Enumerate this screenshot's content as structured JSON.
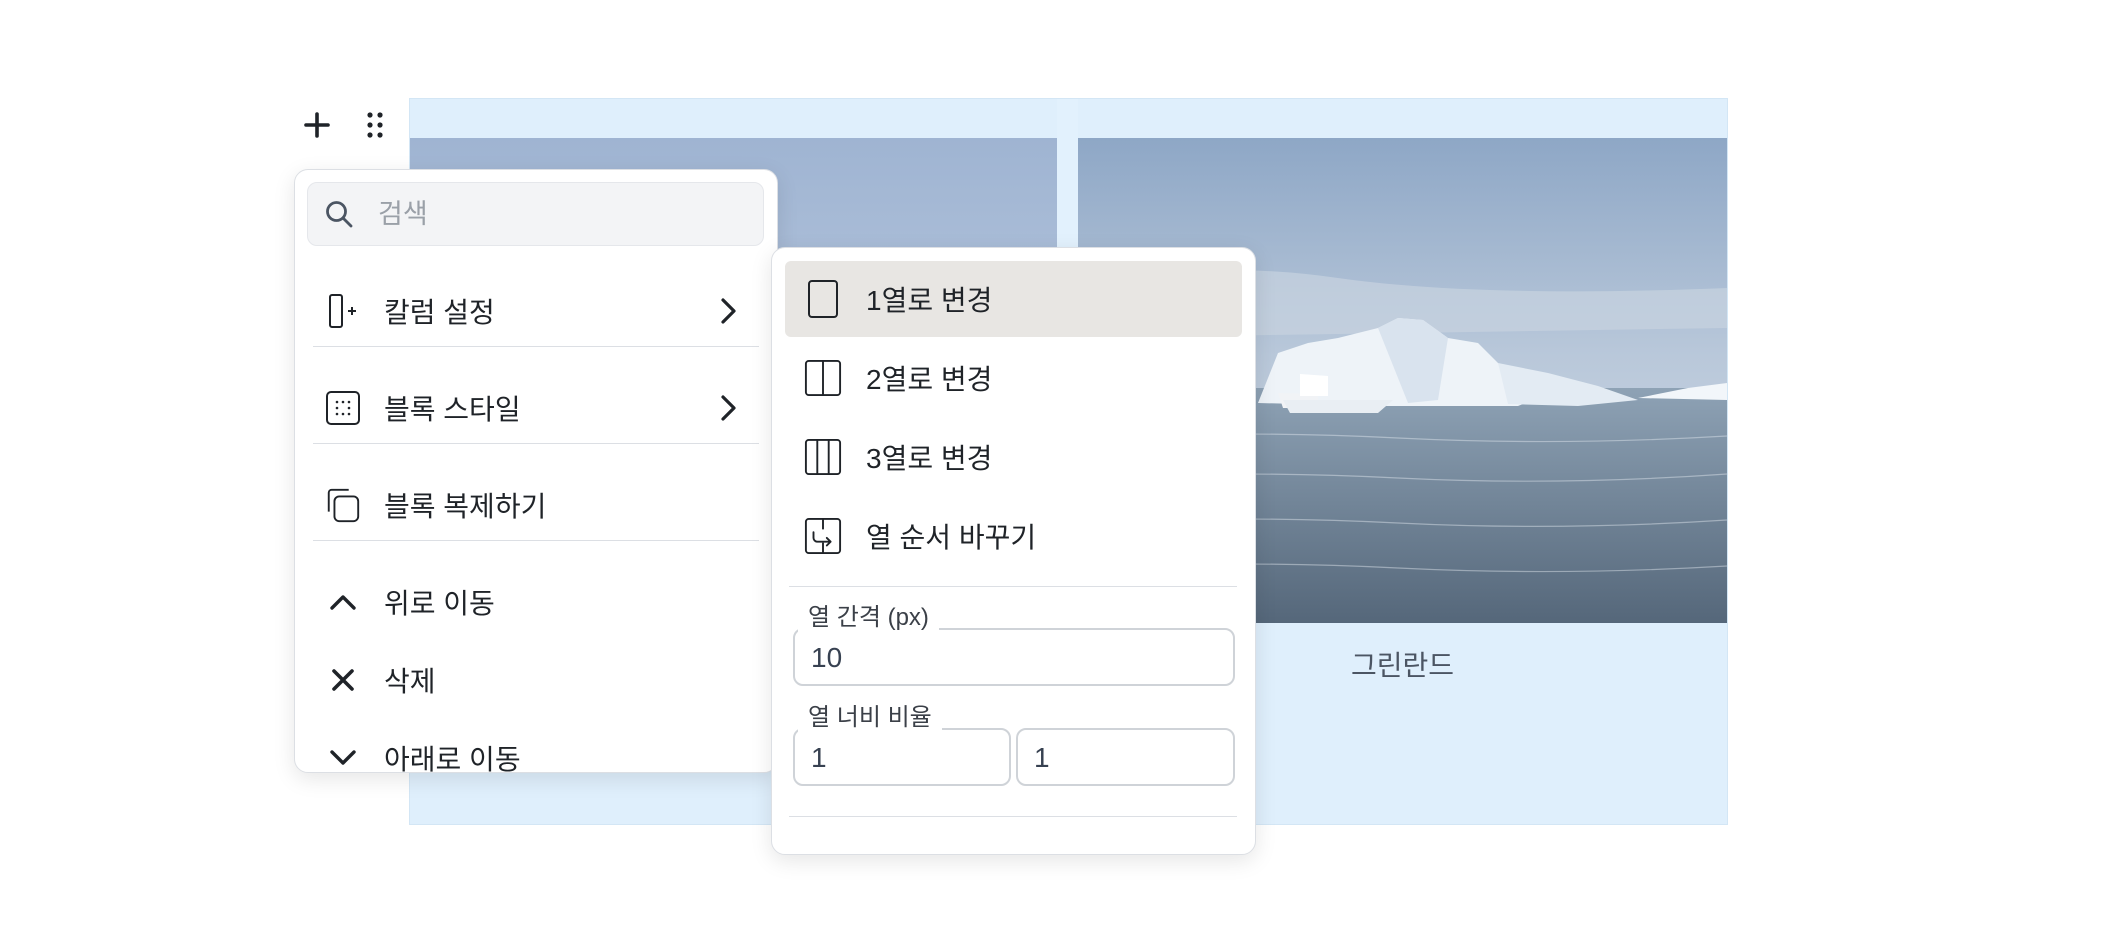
{
  "toolbar": {
    "add_icon": "plus-icon",
    "drag_icon": "drag-dots-icon"
  },
  "columns_block": {
    "right_caption": "그린란드"
  },
  "block_menu": {
    "search": {
      "placeholder": "검색",
      "value": ""
    },
    "items": [
      {
        "label": "칼럼 설정",
        "icon": "column-add-icon",
        "has_submenu": true
      },
      {
        "label": "블록 스타일",
        "icon": "block-style-icon",
        "has_submenu": true
      },
      {
        "label": "블록 복제하기",
        "icon": "duplicate-icon",
        "has_submenu": false
      },
      {
        "label": "위로 이동",
        "icon": "chevron-up-icon",
        "has_submenu": false
      },
      {
        "label": "삭제",
        "icon": "close-icon",
        "has_submenu": false
      },
      {
        "label": "아래로 이동",
        "icon": "chevron-down-icon",
        "has_submenu": false
      }
    ]
  },
  "column_submenu": {
    "items": [
      {
        "label": "1열로 변경",
        "icon": "one-column-icon",
        "selected": true
      },
      {
        "label": "2열로 변경",
        "icon": "two-column-icon",
        "selected": false
      },
      {
        "label": "3열로 변경",
        "icon": "three-column-icon",
        "selected": false
      },
      {
        "label": "열 순서 바꾸기",
        "icon": "swap-columns-icon",
        "selected": false
      }
    ],
    "gap": {
      "label": "열 간격 (px)",
      "value": "10"
    },
    "ratio": {
      "label": "열 너비 비율",
      "values": [
        "1",
        "1"
      ]
    }
  },
  "colors": {
    "column_bg": "#dfeffc",
    "selected_item_bg": "#e8e6e3",
    "border": "#dcdfe4"
  }
}
